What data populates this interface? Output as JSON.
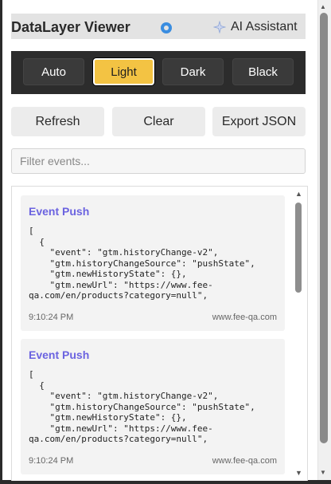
{
  "header": {
    "title": "DataLayer Viewer",
    "ai_label": "AI Assistant"
  },
  "themes": [
    {
      "label": "Auto",
      "active": false
    },
    {
      "label": "Light",
      "active": true
    },
    {
      "label": "Dark",
      "active": false
    },
    {
      "label": "Black",
      "active": false
    }
  ],
  "actions": {
    "refresh": "Refresh",
    "clear": "Clear",
    "export": "Export JSON"
  },
  "filter": {
    "placeholder": "Filter events...",
    "value": ""
  },
  "events": [
    {
      "title": "Event Push",
      "code": "[\n  {\n    \"event\": \"gtm.historyChange-v2\",\n    \"gtm.historyChangeSource\": \"pushState\",\n    \"gtm.newHistoryState\": {},\n    \"gtm.newUrl\": \"https://www.fee-\nqa.com/en/products?category=null\",",
      "time": "9:10:24 PM",
      "domain": "www.fee-qa.com"
    },
    {
      "title": "Event Push",
      "code": "[\n  {\n    \"event\": \"gtm.historyChange-v2\",\n    \"gtm.historyChangeSource\": \"pushState\",\n    \"gtm.newHistoryState\": {},\n    \"gtm.newUrl\": \"https://www.fee-\nqa.com/en/products?category=null\",",
      "time": "9:10:24 PM",
      "domain": "www.fee-qa.com"
    }
  ],
  "colors": {
    "accent": "#f3c343",
    "event_title": "#6b63e0",
    "theme_bar": "#2c2c2c",
    "gear": "#3a8de0"
  }
}
